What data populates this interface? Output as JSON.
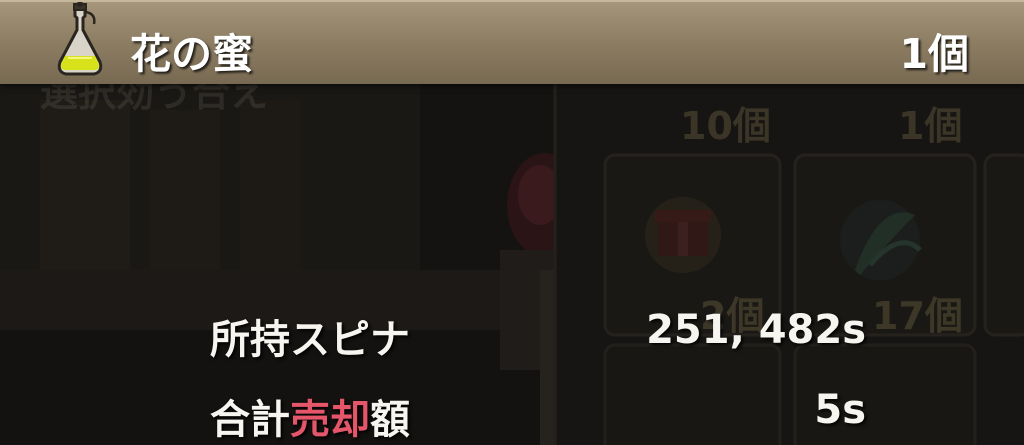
{
  "header": {
    "item_name": "花の蜜",
    "item_count": "1個",
    "icon": "potion-flask-icon"
  },
  "background_panel": {
    "title_faint": "選択効う合え",
    "slots": [
      {
        "count": "10個"
      },
      {
        "count": "1個"
      },
      {
        "count": "2個",
        "icon": "gift-box-icon"
      },
      {
        "count": "17個",
        "icon": "herb-icon"
      }
    ]
  },
  "summary": {
    "held_spina_label": "所持スピナ",
    "held_spina_value": "251, 482s",
    "total_label_prefix": "合計",
    "total_label_accent": "売却",
    "total_label_suffix": "額",
    "total_value": "5s"
  },
  "colors": {
    "header_bg": "#8a7b61",
    "accent_red": "#e5566b",
    "panel_bg": "#141210"
  }
}
